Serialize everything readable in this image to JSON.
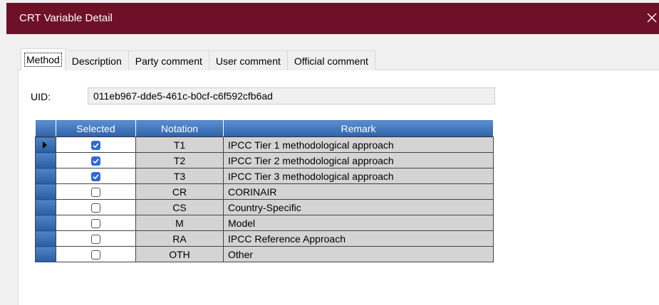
{
  "window": {
    "title": "CRT Variable Detail",
    "close_glyph": "✕",
    "titlebar_color": "#6e1028"
  },
  "tabs": [
    {
      "label": "Method",
      "active": true
    },
    {
      "label": "Description",
      "active": false
    },
    {
      "label": "Party comment",
      "active": false
    },
    {
      "label": "User comment",
      "active": false
    },
    {
      "label": "Official comment",
      "active": false
    }
  ],
  "uid": {
    "label": "UID:",
    "value": "011eb967-dde5-461c-b0cf-c6f592cfb6ad"
  },
  "grid": {
    "columns": [
      "Selected",
      "Notation",
      "Remark"
    ],
    "header_color": "#3d6fb3",
    "rows": [
      {
        "selected": true,
        "notation": "T1",
        "remark": "IPCC Tier 1 methodological approach",
        "current": true
      },
      {
        "selected": true,
        "notation": "T2",
        "remark": "IPCC Tier 2 methodological approach",
        "current": false
      },
      {
        "selected": true,
        "notation": "T3",
        "remark": "IPCC Tier 3 methodological approach",
        "current": false
      },
      {
        "selected": false,
        "notation": "CR",
        "remark": "CORINAIR",
        "current": false
      },
      {
        "selected": false,
        "notation": "CS",
        "remark": "Country-Specific",
        "current": false
      },
      {
        "selected": false,
        "notation": "M",
        "remark": "Model",
        "current": false
      },
      {
        "selected": false,
        "notation": "RA",
        "remark": "IPCC Reference Approach",
        "current": false
      },
      {
        "selected": false,
        "notation": "OTH",
        "remark": "Other",
        "current": false
      }
    ]
  }
}
